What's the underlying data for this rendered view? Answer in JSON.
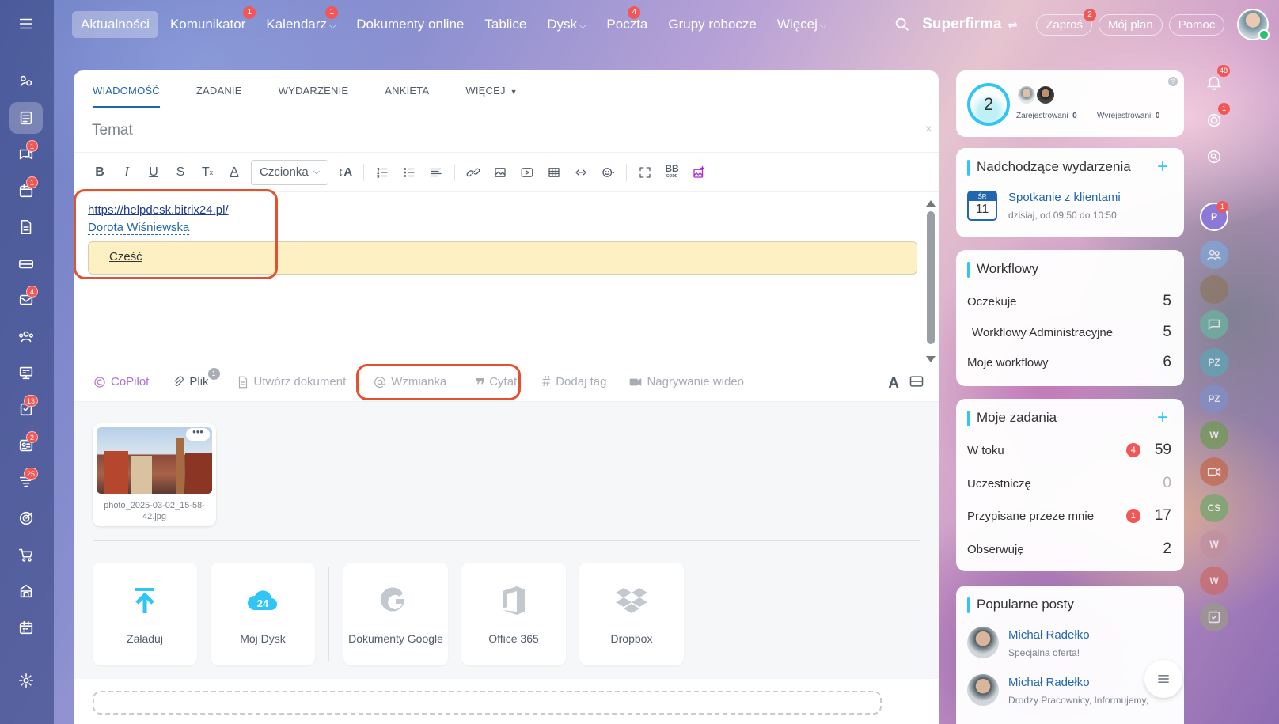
{
  "colors": {
    "accent": "#2067b0",
    "highlight": "#e5502e",
    "badge": "#f25757",
    "widget_accent": "#2fc6f6",
    "quote_bg": "#fdf1c3"
  },
  "left_rail": {
    "items": [
      {
        "name": "menu-icon",
        "badge": ""
      },
      {
        "name": "collab-icon",
        "badge": ""
      },
      {
        "name": "feed-icon",
        "badge": "",
        "active": true
      },
      {
        "name": "chat-icon",
        "badge": "1"
      },
      {
        "name": "calendar-icon",
        "badge": "1"
      },
      {
        "name": "document-icon",
        "badge": ""
      },
      {
        "name": "drive-icon",
        "badge": ""
      },
      {
        "name": "mail-icon",
        "badge": "4"
      },
      {
        "name": "groups-icon",
        "badge": ""
      },
      {
        "name": "board-icon",
        "badge": ""
      },
      {
        "name": "tasks-icon",
        "badge": "13"
      },
      {
        "name": "crm-icon",
        "badge": "2"
      },
      {
        "name": "funnel-icon",
        "badge": "25"
      },
      {
        "name": "target-icon",
        "badge": ""
      },
      {
        "name": "cart-icon",
        "badge": ""
      },
      {
        "name": "store-icon",
        "badge": ""
      },
      {
        "name": "schedule-icon",
        "badge": ""
      },
      {
        "name": "settings-icon",
        "badge": ""
      }
    ]
  },
  "topnav": {
    "items": [
      {
        "label": "Aktualności",
        "badge": "",
        "chevron": false,
        "active": true
      },
      {
        "label": "Komunikator",
        "badge": "1",
        "chevron": false
      },
      {
        "label": "Kalendarz",
        "badge": "1",
        "chevron": true
      },
      {
        "label": "Dokumenty online",
        "badge": "",
        "chevron": false
      },
      {
        "label": "Tablice",
        "badge": "",
        "chevron": false
      },
      {
        "label": "Dysk",
        "badge": "",
        "chevron": true
      },
      {
        "label": "Poczta",
        "badge": "4",
        "chevron": false
      },
      {
        "label": "Grupy robocze",
        "badge": "",
        "chevron": false
      },
      {
        "label": "Więcej",
        "badge": "",
        "chevron": true
      }
    ],
    "company": "Superfirma",
    "invite": {
      "label": "Zaproś",
      "badge": "2"
    },
    "myplan": "Mój plan",
    "help": "Pomoc"
  },
  "composer": {
    "tabs": [
      "WIADOMOŚĆ",
      "ZADANIE",
      "WYDARZENIE",
      "ANKIETA",
      "WIĘCEJ"
    ],
    "subject_placeholder": "Temat",
    "font_select": "Czcionka",
    "content": {
      "link": "https://helpdesk.bitrix24.pl/",
      "mention": "Dorota Wiśniewska",
      "quote": "Cześć"
    },
    "actions": {
      "copilot": "CoPilot",
      "file": "Plik",
      "file_badge": "1",
      "create_doc": "Utwórz dokument",
      "mention": "Wzmianka",
      "quote": "Cytat",
      "tag": "Dodaj tag",
      "video": "Nagrywanie wideo"
    },
    "attachment": {
      "filename": "photo_2025-03-02_15-58-42.jpg"
    },
    "sources": [
      "Załaduj",
      "Mój Dysk",
      "Dokumenty Google",
      "Office 365",
      "Dropbox"
    ]
  },
  "widgets": {
    "stats": {
      "count": "2",
      "registered_label": "Zarejestrowani",
      "registered": "0",
      "unregistered_label": "Wyrejestrowani",
      "unregistered": "0"
    },
    "events": {
      "title": "Nadchodzące wydarzenia",
      "day_abbr": "ŚR",
      "day": "11",
      "event_title": "Spotkanie z klientami",
      "event_time": "dzisiaj, od 09:50 do 10:50"
    },
    "workflows": {
      "title": "Workflowy",
      "rows": [
        {
          "label": "Oczekuje",
          "value": "5"
        },
        {
          "label": "Workflowy Administracyjne",
          "value": "5"
        },
        {
          "label": "Moje workflowy",
          "value": "6"
        }
      ]
    },
    "tasks": {
      "title": "Moje zadania",
      "rows": [
        {
          "label": "W toku",
          "badge": "4",
          "value": "59"
        },
        {
          "label": "Uczestniczę",
          "badge": "",
          "value": "0"
        },
        {
          "label": "Przypisane przeze mnie",
          "badge": "1",
          "value": "17"
        },
        {
          "label": "Obserwuję",
          "badge": "",
          "value": "2"
        }
      ]
    },
    "popular": {
      "title": "Popularne posty",
      "posts": [
        {
          "author": "Michał Radełko",
          "text": "Specjalna oferta!"
        },
        {
          "author": "Michał Radełko",
          "text": "Drodzy Pracownicy, Informujemy,"
        }
      ]
    }
  },
  "right_rail": {
    "notifications_badge": "48",
    "items": [
      {
        "name": "bell-icon",
        "badge": "48"
      },
      {
        "name": "copilot-rail-icon",
        "badge": "1"
      },
      {
        "name": "search-chat-icon",
        "badge": ""
      },
      {
        "name": "avatar-p",
        "initials": "P",
        "badge": "1"
      },
      {
        "name": "avatar-group",
        "initials": "",
        "badge": ""
      },
      {
        "name": "avatar-photo",
        "initials": "",
        "badge": ""
      },
      {
        "name": "avatar-chat",
        "initials": "",
        "badge": ""
      },
      {
        "name": "avatar-pz-1",
        "initials": "PZ",
        "badge": ""
      },
      {
        "name": "avatar-pz-2",
        "initials": "PZ",
        "badge": ""
      },
      {
        "name": "avatar-w-1",
        "initials": "W",
        "badge": ""
      },
      {
        "name": "avatar-video",
        "initials": "",
        "badge": ""
      },
      {
        "name": "avatar-cs",
        "initials": "CS",
        "badge": ""
      },
      {
        "name": "avatar-w-2",
        "initials": "W",
        "badge": ""
      },
      {
        "name": "avatar-w-3",
        "initials": "W",
        "badge": ""
      },
      {
        "name": "avatar-task",
        "initials": "",
        "badge": ""
      }
    ]
  }
}
